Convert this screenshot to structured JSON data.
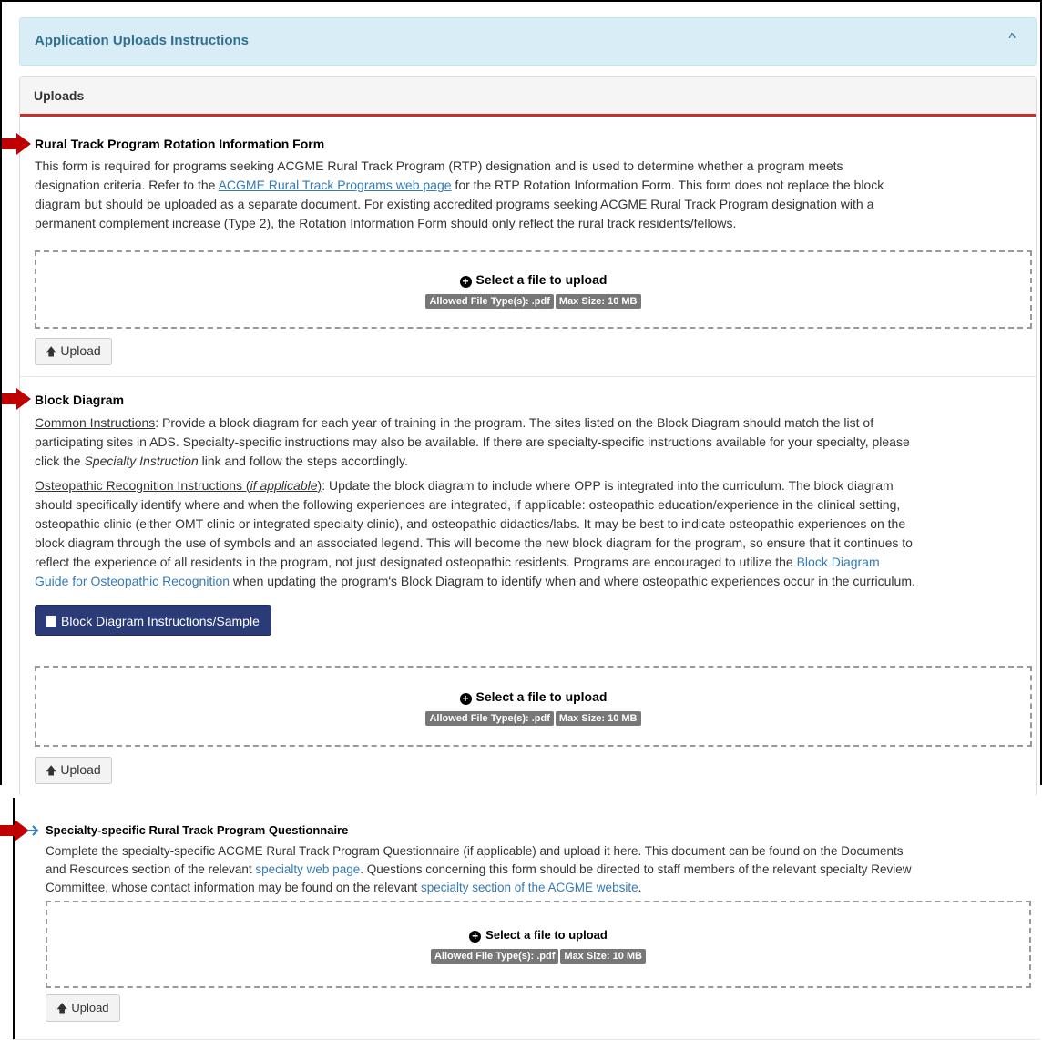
{
  "accordion": {
    "title": "Application Uploads Instructions",
    "caret": "^"
  },
  "panel": {
    "title": "Uploads"
  },
  "rtp_form": {
    "title": "Rural Track Program Rotation Information Form",
    "p1": "This form is required for programs seeking ACGME Rural Track Program (RTP) designation and is used to determine whether a program meets",
    "p2a": "designation criteria. Refer to the ",
    "p2link": "ACGME Rural Track Programs web page",
    "p2b": " for the RTP Rotation Information Form. This form does not replace the block",
    "p3": "diagram but should be uploaded as a separate document. For existing accredited programs seeking ACGME Rural Track Program designation with a",
    "p4": "permanent complement increase (Type 2), the Rotation Information Form should only reflect the rural track residents/fellows."
  },
  "upload": {
    "select_label": "Select a file to upload",
    "allowed": "Allowed File Type(s): .pdf",
    "max_size": "Max Size: 10 MB",
    "button_label": "Upload"
  },
  "block_diagram": {
    "title": "Block Diagram",
    "common_label": "Common Instructions",
    "common_l1": ": Provide a block diagram for each year of training in the program. The sites listed on the Block Diagram should match the list of",
    "common_l2": "participating sites in ADS. Specialty-specific instructions may also be available. If there are specialty-specific instructions available for your specialty, please",
    "common_l3a": "click the ",
    "common_l3i": "Specialty Instruction",
    "common_l3b": " link and follow the steps accordingly.",
    "osteo_label_a": "Osteopathic Recognition Instructions (",
    "osteo_label_i": "if applicable",
    "osteo_label_b": ")",
    "osteo_l1": ": Update the block diagram to include where OPP is integrated into the curriculum. The block diagram",
    "osteo_l2": "should specifically identify where and when the following experiences are integrated, if applicable: osteopathic education/experience in the clinical setting,",
    "osteo_l3": "osteopathic clinic (either OMT clinic or integrated specialty clinic), and osteopathic didactics/labs. It may be best to indicate osteopathic experiences on the",
    "osteo_l4": "block diagram through the use of symbols and an associated legend. This will become the new block diagram for the program, so ensure that it continues to",
    "osteo_l5a": "reflect the experience of all residents in the program, not just designated osteopathic residents. Programs are encouraged to utilize the ",
    "osteo_l5link": "Block Diagram",
    "osteo_l6link": "Guide for Osteopathic Recognition",
    "osteo_l6b": " when updating the program's Block Diagram to identify when and where osteopathic experiences occur in the curriculum.",
    "instructions_button": "Block Diagram Instructions/Sample"
  },
  "questionnaire": {
    "title": "Specialty-specific Rural Track Program Questionnaire",
    "l1": "Complete the specialty-specific ACGME Rural Track Program Questionnaire (if applicable) and upload it here. This document can be found on the Documents",
    "l2a": "and Resources section of the relevant ",
    "l2link": "specialty web page",
    "l2b": ". Questions concerning this form should be directed to staff members of the relevant specialty Review",
    "l3a": "Committee, whose contact information may be found on the relevant ",
    "l3link": "specialty section of the ACGME website",
    "l3b": "."
  },
  "colors": {
    "arrow": "#c00000",
    "accent": "#c9302c",
    "primary_button": "#2a3b78",
    "link": "#337ab7"
  }
}
